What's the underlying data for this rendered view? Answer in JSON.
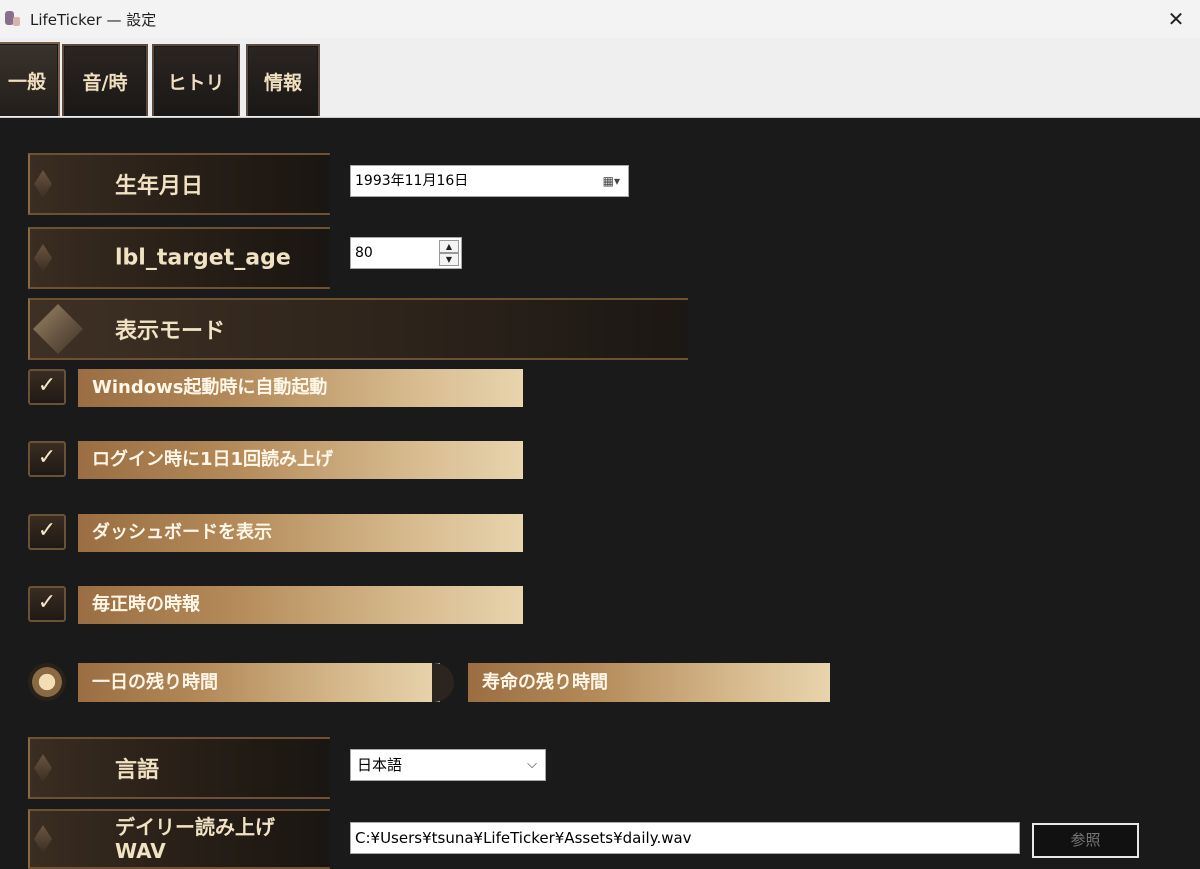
{
  "window": {
    "title": "LifeTicker — 設定",
    "close_glyph": "✕"
  },
  "tabs": [
    {
      "label": "一般"
    },
    {
      "label": "音/時"
    },
    {
      "label": "ヒトリ"
    },
    {
      "label": "情報"
    }
  ],
  "fields": {
    "birthdate": {
      "label": "生年月日",
      "value": "1993年11月16日"
    },
    "target_age": {
      "label": "lbl_target_age",
      "value": "80"
    },
    "display_mode": {
      "label": "表示モード"
    },
    "language": {
      "label": "言語",
      "value": "日本語"
    },
    "daily_wav": {
      "label_line1": "デイリー読み上げ",
      "label_line2": "WAV",
      "path": "C:¥Users¥tsuna¥LifeTicker¥Assets¥daily.wav",
      "browse_label": "参照"
    }
  },
  "checkboxes": [
    {
      "label": "Windows起動時に自動起動",
      "checked": true
    },
    {
      "label": "ログイン時に1日1回読み上げ",
      "checked": true
    },
    {
      "label": "ダッシュボードを表示",
      "checked": true
    },
    {
      "label": "毎正時の時報",
      "checked": true
    }
  ],
  "radios": {
    "option1": {
      "label": "一日の残り時間",
      "selected": true
    },
    "option2": {
      "label": "寿命の残り時間",
      "selected": false
    }
  },
  "colors": {
    "accent_gold": "#c9a46f",
    "background": "#1a1a1a"
  }
}
